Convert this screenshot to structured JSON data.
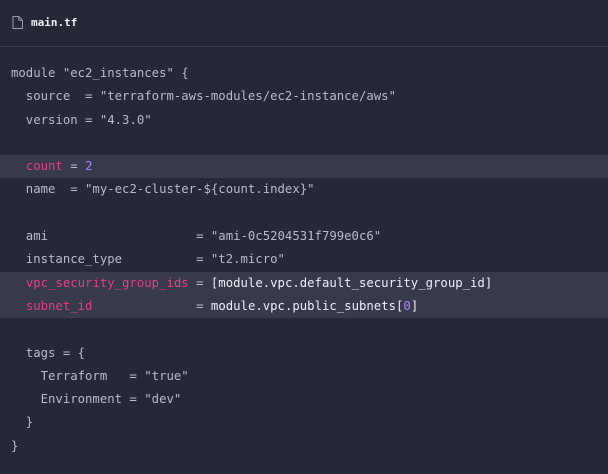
{
  "file": {
    "icon": "file-icon",
    "name": "main.tf"
  },
  "code": {
    "lines": [
      {
        "highlight": false,
        "tokens": [
          {
            "text": "module \"ec2_instances\" {",
            "style": "plain"
          }
        ]
      },
      {
        "highlight": false,
        "tokens": [
          {
            "text": "  source  = \"terraform-aws-modules/ec2-instance/aws\"",
            "style": "plain"
          }
        ]
      },
      {
        "highlight": false,
        "tokens": [
          {
            "text": "  version = \"4.3.0\"",
            "style": "plain"
          }
        ]
      },
      {
        "highlight": false,
        "tokens": []
      },
      {
        "highlight": true,
        "tokens": [
          {
            "text": "  ",
            "style": "plain"
          },
          {
            "text": "count",
            "style": "pink"
          },
          {
            "text": " = ",
            "style": "plain"
          },
          {
            "text": "2",
            "style": "purple"
          }
        ]
      },
      {
        "highlight": false,
        "tokens": [
          {
            "text": "  name  = \"my-ec2-cluster-${count.index}\"",
            "style": "plain"
          }
        ]
      },
      {
        "highlight": false,
        "tokens": []
      },
      {
        "highlight": false,
        "tokens": [
          {
            "text": "  ami                    = \"ami-0c5204531f799e0c6\"",
            "style": "plain"
          }
        ]
      },
      {
        "highlight": false,
        "tokens": [
          {
            "text": "  instance_type          = \"t2.micro\"",
            "style": "plain"
          }
        ]
      },
      {
        "highlight": true,
        "tokens": [
          {
            "text": "  ",
            "style": "plain"
          },
          {
            "text": "vpc_security_group_ids",
            "style": "pink"
          },
          {
            "text": " = ",
            "style": "plain"
          },
          {
            "text": "[module.vpc.default_security_group_id]",
            "style": "white"
          }
        ]
      },
      {
        "highlight": true,
        "tokens": [
          {
            "text": "  ",
            "style": "plain"
          },
          {
            "text": "subnet_id",
            "style": "pink"
          },
          {
            "text": "              = ",
            "style": "plain"
          },
          {
            "text": "module.vpc.public_subnets[",
            "style": "white"
          },
          {
            "text": "0",
            "style": "purple"
          },
          {
            "text": "]",
            "style": "white"
          }
        ]
      },
      {
        "highlight": false,
        "tokens": []
      },
      {
        "highlight": false,
        "tokens": [
          {
            "text": "  tags = {",
            "style": "plain"
          }
        ]
      },
      {
        "highlight": false,
        "tokens": [
          {
            "text": "    Terraform   = \"true\"",
            "style": "plain"
          }
        ]
      },
      {
        "highlight": false,
        "tokens": [
          {
            "text": "    Environment = \"dev\"",
            "style": "plain"
          }
        ]
      },
      {
        "highlight": false,
        "tokens": [
          {
            "text": "  }",
            "style": "plain"
          }
        ]
      },
      {
        "highlight": false,
        "tokens": [
          {
            "text": "}",
            "style": "plain"
          }
        ]
      }
    ]
  }
}
